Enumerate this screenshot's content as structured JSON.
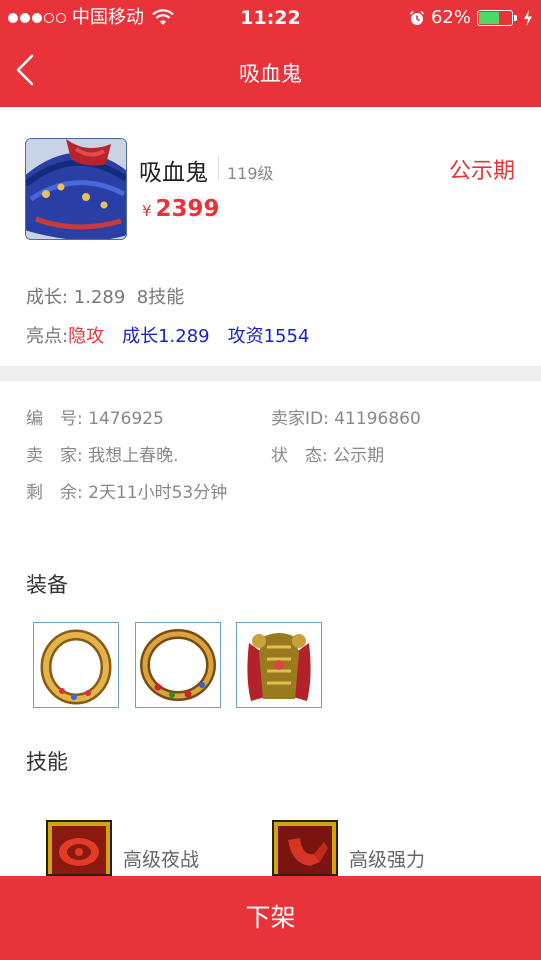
{
  "status_bar": {
    "carrier": "中国移动",
    "time": "11:22",
    "battery": "62%",
    "battery_level": 0.62,
    "signal_bars_filled": 3,
    "signal_bars_total": 5
  },
  "nav": {
    "title": "吸血鬼",
    "back_icon": "chevron-left-icon"
  },
  "pet": {
    "name": "吸血鬼",
    "level": "119级",
    "status": "公示期",
    "currency": "¥",
    "price": "2399",
    "growth_line": "成长: 1.289  8技能",
    "highlights_label": "亮点:",
    "highlights": [
      {
        "text": "隐攻",
        "color": "#e8333a"
      },
      {
        "text": "成长1.289",
        "color": "#1a22c9"
      },
      {
        "text": "攻资1554",
        "color": "#1a22c9"
      }
    ]
  },
  "info": {
    "number": "编　号: 1476925",
    "seller_id": "卖家ID: 41196860",
    "seller": "卖　家: 我想上春晚.",
    "state": "状　态: 公示期",
    "remaining": "剩　余: 2天11小时53分钟"
  },
  "equipment": {
    "title": "装备",
    "items": [
      {
        "icon": "gold-ring-icon"
      },
      {
        "icon": "jeweled-ring-icon"
      },
      {
        "icon": "armor-icon"
      }
    ]
  },
  "skills": {
    "title": "技能",
    "items": [
      {
        "name": "高级夜战",
        "icon": "night-battle-icon"
      },
      {
        "name": "高级强力",
        "icon": "strength-icon"
      }
    ]
  },
  "action": {
    "label": "下架"
  },
  "colors": {
    "primary": "#e8333a",
    "blue_text": "#1a22c9",
    "separator": "#eeeeee"
  }
}
